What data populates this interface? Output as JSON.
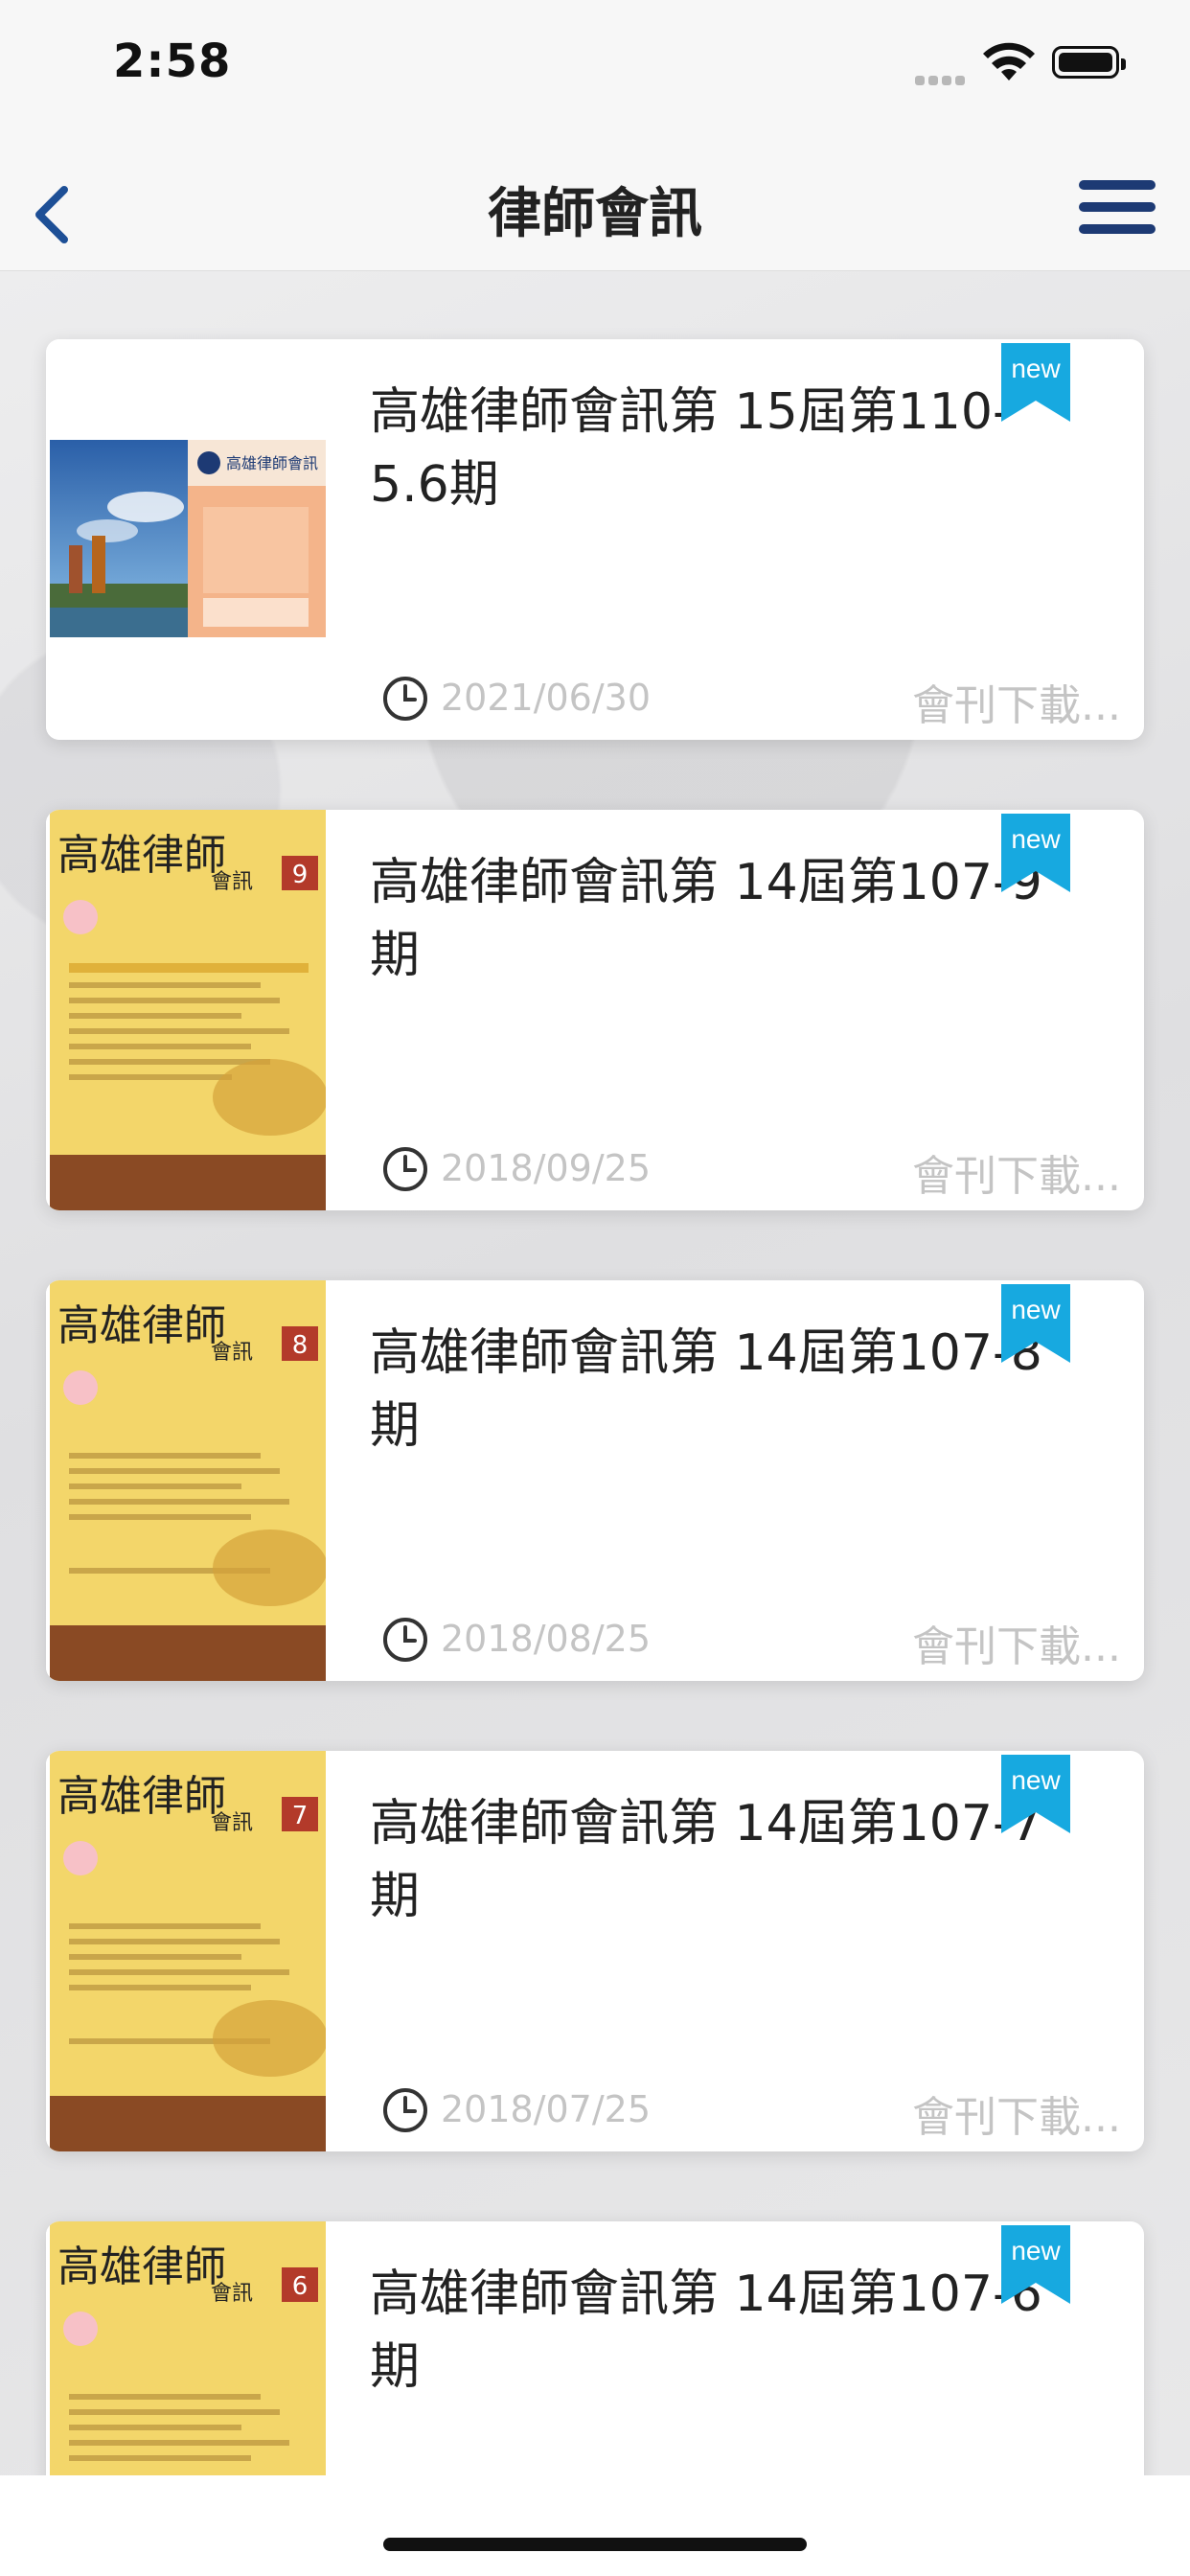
{
  "status_bar": {
    "time": "2:58"
  },
  "navbar": {
    "title": "律師會訊"
  },
  "items": [
    {
      "title": "高雄律師會訊第 15屆第110-5.6期",
      "date": "2021/06/30",
      "action": "會刊下載...",
      "badge": "new",
      "cover": "高雄律師會訊 cover",
      "issue": ""
    },
    {
      "title": "高雄律師會訊第 14屆第107-9 期",
      "date": "2018/09/25",
      "action": "會刊下載...",
      "badge": "new",
      "cover": "高雄律師 會訊",
      "issue": "9"
    },
    {
      "title": "高雄律師會訊第 14屆第107-8 期",
      "date": "2018/08/25",
      "action": "會刊下載...",
      "badge": "new",
      "cover": "高雄律師 會訊",
      "issue": "8"
    },
    {
      "title": "高雄律師會訊第 14屆第107-7 期",
      "date": "2018/07/25",
      "action": "會刊下載...",
      "badge": "new",
      "cover": "高雄律師 會訊",
      "issue": "7"
    },
    {
      "title": "高雄律師會訊第 14屆第107-6 期",
      "date": "",
      "action": "",
      "badge": "new",
      "cover": "高雄律師 會訊",
      "issue": "6"
    }
  ],
  "cover_texts": {
    "first_header": "高雄律師會訊",
    "yellow_header": "高雄律師",
    "yellow_sub": "會訊"
  }
}
